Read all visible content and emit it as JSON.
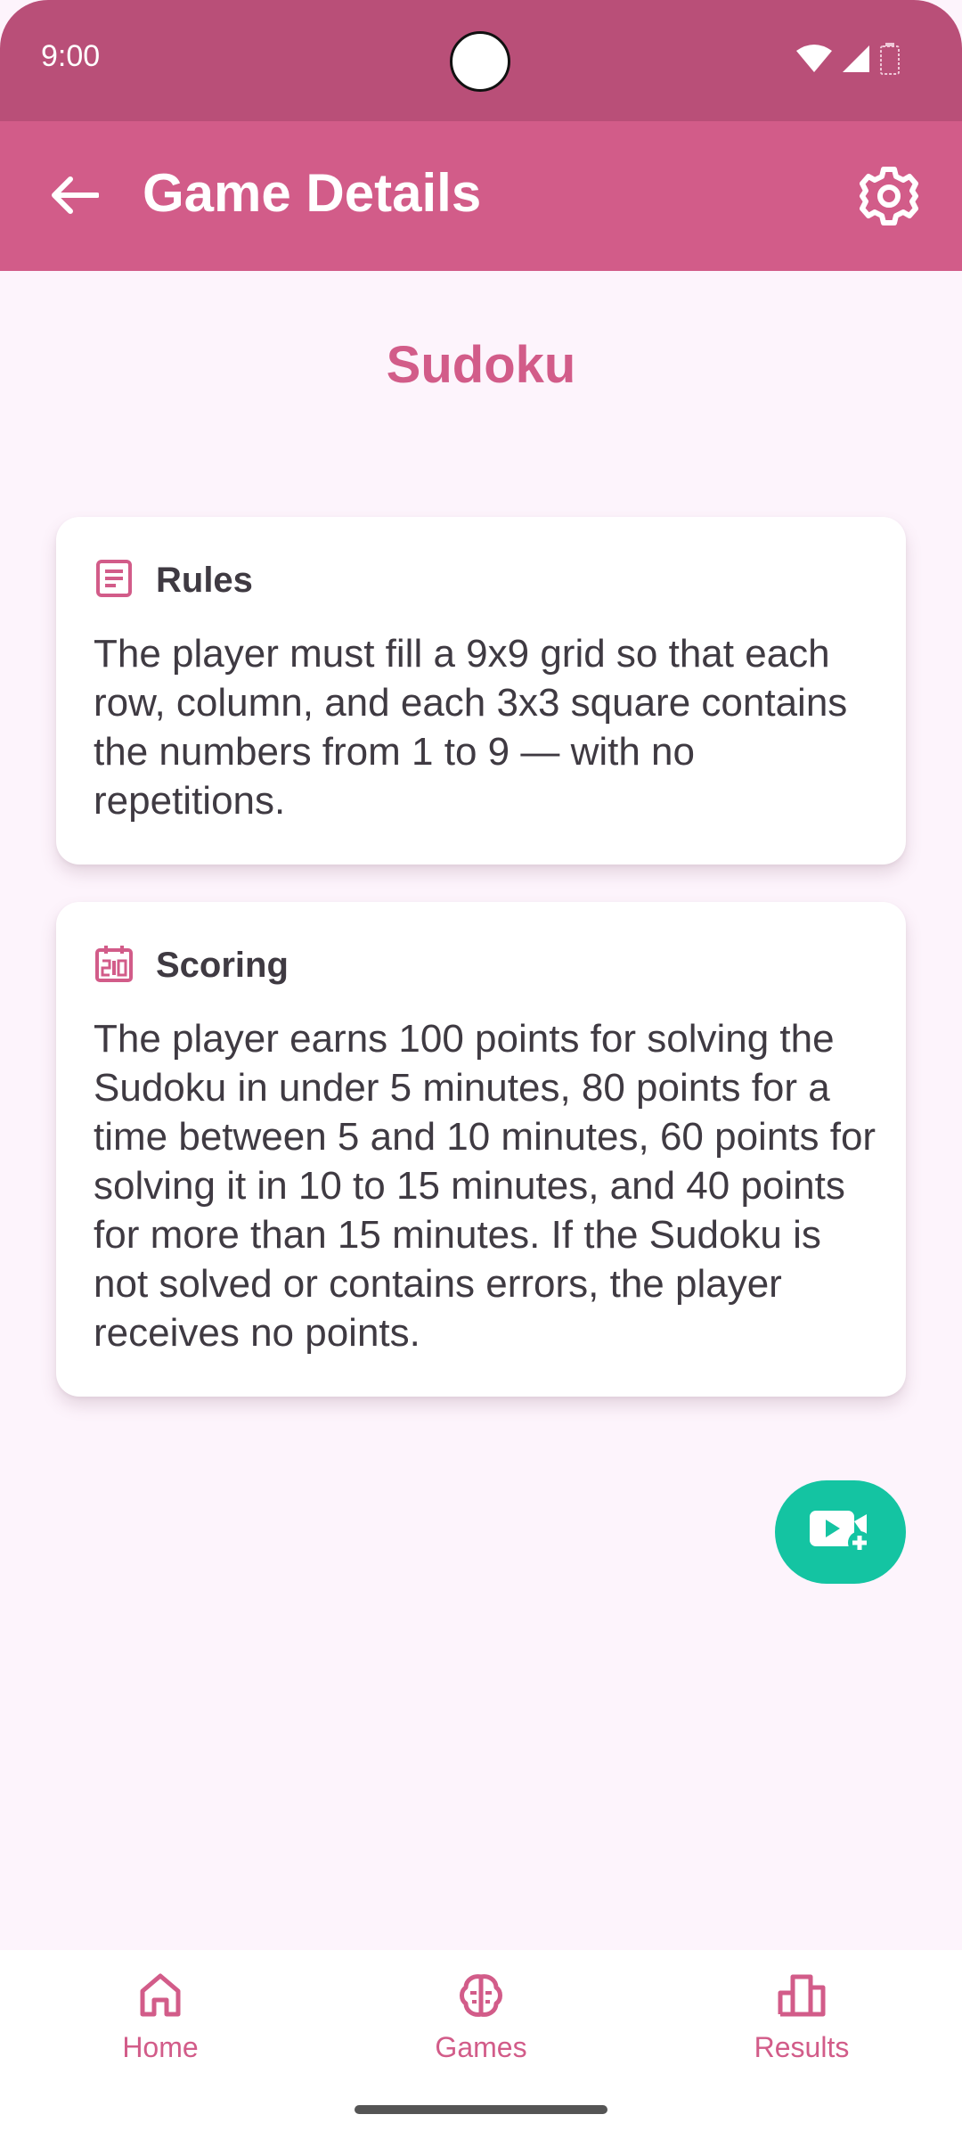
{
  "status_bar": {
    "time": "9:00",
    "icons": [
      "wifi-icon",
      "signal-icon",
      "battery-icon"
    ]
  },
  "app_bar": {
    "title": "Game Details",
    "back_icon": "arrow-left-icon",
    "settings_icon": "gear-icon"
  },
  "game": {
    "title": "Sudoku"
  },
  "rules": {
    "icon": "document-icon",
    "title": "Rules",
    "text": "The player must fill a 9x9 grid so that each row, column, and each 3x3 square contains the numbers from 1 to 9 — with no repetitions."
  },
  "scoring": {
    "icon": "scoreboard-icon",
    "title": "Scoring",
    "text": "The player earns 100 points for solving the Sudoku in under 5 minutes, 80 points for a time between 5 and 10 minutes, 60 points for solving it in 10 to 15 minutes, and 40 points for more than 15 minutes. If the Sudoku is not solved or contains errors, the player receives no points."
  },
  "fab": {
    "icon": "video-add-icon"
  },
  "bottom_nav": {
    "items": [
      {
        "label": "Home",
        "icon": "home-icon"
      },
      {
        "label": "Games",
        "icon": "brain-icon"
      },
      {
        "label": "Results",
        "icon": "bar-chart-icon"
      }
    ]
  },
  "colors": {
    "status_bar": "#b94f78",
    "app_bar": "#d25c89",
    "accent": "#d25c89",
    "fab": "#14c4a2",
    "background": "#fdf4fc"
  }
}
